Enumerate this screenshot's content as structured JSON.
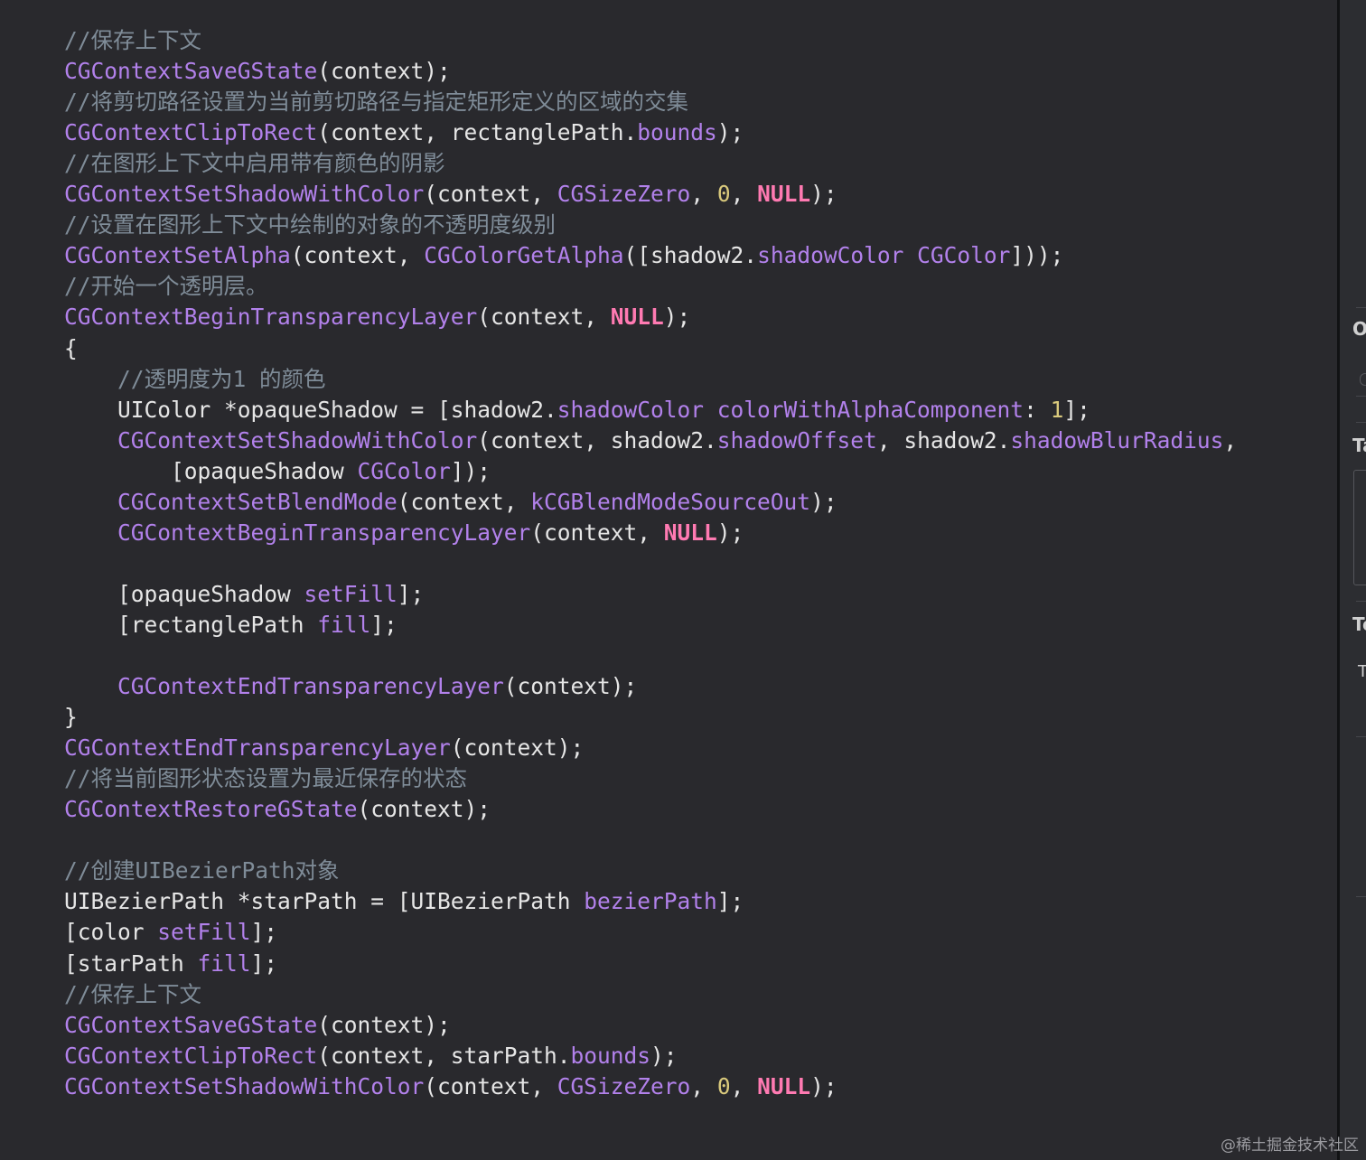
{
  "colors": {
    "background": "#29292d",
    "comment": "#7f8c98",
    "function": "#b281eb",
    "keyword": "#ff7ab2",
    "number": "#d9c97c",
    "plain": "#e6e6e6"
  },
  "code_lines": [
    [
      [
        "c",
        "//保存上下文"
      ]
    ],
    [
      [
        "f",
        "CGContextSaveGState"
      ],
      [
        "p",
        "(context);"
      ]
    ],
    [
      [
        "c",
        "//将剪切路径设置为当前剪切路径与指定矩形定义的区域的交集"
      ]
    ],
    [
      [
        "f",
        "CGContextClipToRect"
      ],
      [
        "p",
        "(context, rectanglePath."
      ],
      [
        "f",
        "bounds"
      ],
      [
        "p",
        ");"
      ]
    ],
    [
      [
        "c",
        "//在图形上下文中启用带有颜色的阴影"
      ]
    ],
    [
      [
        "f",
        "CGContextSetShadowWithColor"
      ],
      [
        "p",
        "(context, "
      ],
      [
        "f",
        "CGSizeZero"
      ],
      [
        "p",
        ", "
      ],
      [
        "n",
        "0"
      ],
      [
        "p",
        ", "
      ],
      [
        "k",
        "NULL"
      ],
      [
        "p",
        ");"
      ]
    ],
    [
      [
        "c",
        "//设置在图形上下文中绘制的对象的不透明度级别"
      ]
    ],
    [
      [
        "f",
        "CGContextSetAlpha"
      ],
      [
        "p",
        "(context, "
      ],
      [
        "f",
        "CGColorGetAlpha"
      ],
      [
        "p",
        "([shadow2."
      ],
      [
        "f",
        "shadowColor"
      ],
      [
        "p",
        " "
      ],
      [
        "f",
        "CGColor"
      ],
      [
        "p",
        "]));"
      ]
    ],
    [
      [
        "c",
        "//开始一个透明层。"
      ]
    ],
    [
      [
        "f",
        "CGContextBeginTransparencyLayer"
      ],
      [
        "p",
        "(context, "
      ],
      [
        "k",
        "NULL"
      ],
      [
        "p",
        ");"
      ]
    ],
    [
      [
        "p",
        "{"
      ]
    ],
    [
      [
        "p",
        "    "
      ],
      [
        "c",
        "//透明度为1 的颜色"
      ]
    ],
    [
      [
        "p",
        "    UIColor *opaqueShadow = [shadow2."
      ],
      [
        "f",
        "shadowColor"
      ],
      [
        "p",
        " "
      ],
      [
        "f",
        "colorWithAlphaComponent"
      ],
      [
        "p",
        ": "
      ],
      [
        "n",
        "1"
      ],
      [
        "p",
        "];"
      ]
    ],
    [
      [
        "p",
        "    "
      ],
      [
        "f",
        "CGContextSetShadowWithColor"
      ],
      [
        "p",
        "(context, shadow2."
      ],
      [
        "f",
        "shadowOffset"
      ],
      [
        "p",
        ", shadow2."
      ],
      [
        "f",
        "shadowBlurRadius"
      ],
      [
        "p",
        ","
      ]
    ],
    [
      [
        "p",
        "        [opaqueShadow "
      ],
      [
        "f",
        "CGColor"
      ],
      [
        "p",
        "]);"
      ]
    ],
    [
      [
        "p",
        "    "
      ],
      [
        "f",
        "CGContextSetBlendMode"
      ],
      [
        "p",
        "(context, "
      ],
      [
        "f",
        "kCGBlendModeSourceOut"
      ],
      [
        "p",
        ");"
      ]
    ],
    [
      [
        "p",
        "    "
      ],
      [
        "f",
        "CGContextBeginTransparencyLayer"
      ],
      [
        "p",
        "(context, "
      ],
      [
        "k",
        "NULL"
      ],
      [
        "p",
        ");"
      ]
    ],
    [],
    [
      [
        "p",
        "    [opaqueShadow "
      ],
      [
        "f",
        "setFill"
      ],
      [
        "p",
        "];"
      ]
    ],
    [
      [
        "p",
        "    [rectanglePath "
      ],
      [
        "f",
        "fill"
      ],
      [
        "p",
        "];"
      ]
    ],
    [],
    [
      [
        "p",
        "    "
      ],
      [
        "f",
        "CGContextEndTransparencyLayer"
      ],
      [
        "p",
        "(context);"
      ]
    ],
    [
      [
        "p",
        "}"
      ]
    ],
    [
      [
        "f",
        "CGContextEndTransparencyLayer"
      ],
      [
        "p",
        "(context);"
      ]
    ],
    [
      [
        "c",
        "//将当前图形状态设置为最近保存的状态"
      ]
    ],
    [
      [
        "f",
        "CGContextRestoreGState"
      ],
      [
        "p",
        "(context);"
      ]
    ],
    [],
    [
      [
        "c",
        "//创建UIBezierPath对象"
      ]
    ],
    [
      [
        "p",
        "UIBezierPath *starPath = [UIBezierPath "
      ],
      [
        "f",
        "bezierPath"
      ],
      [
        "p",
        "];"
      ]
    ],
    [
      [
        "p",
        "[color "
      ],
      [
        "f",
        "setFill"
      ],
      [
        "p",
        "];"
      ]
    ],
    [
      [
        "p",
        "[starPath "
      ],
      [
        "f",
        "fill"
      ],
      [
        "p",
        "];"
      ]
    ],
    [
      [
        "c",
        "//保存上下文"
      ]
    ],
    [
      [
        "f",
        "CGContextSaveGState"
      ],
      [
        "p",
        "(context);"
      ]
    ],
    [
      [
        "f",
        "CGContextClipToRect"
      ],
      [
        "p",
        "(context, starPath."
      ],
      [
        "f",
        "bounds"
      ],
      [
        "p",
        ");"
      ]
    ],
    [
      [
        "f",
        "CGContextSetShadowWithColor"
      ],
      [
        "p",
        "(context, "
      ],
      [
        "f",
        "CGSizeZero"
      ],
      [
        "p",
        ", "
      ],
      [
        "n",
        "0"
      ],
      [
        "p",
        ", "
      ],
      [
        "k",
        "NULL"
      ],
      [
        "p",
        ");"
      ]
    ]
  ],
  "inspector": {
    "label_1": "O",
    "label_2": "Ta",
    "label_3": "Te",
    "label_4": "T"
  },
  "watermark": "@稀土掘金技术社区"
}
